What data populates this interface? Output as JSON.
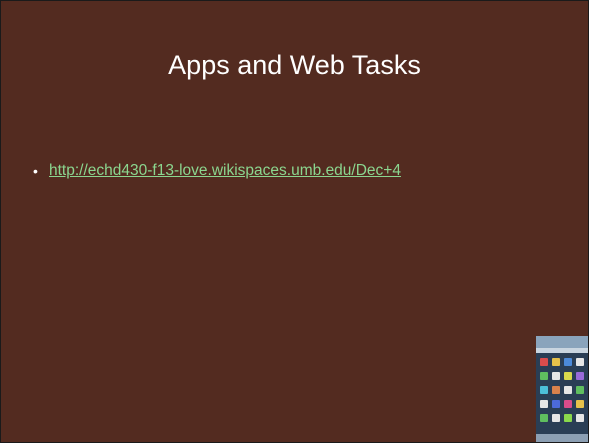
{
  "slide": {
    "title": "Apps and Web Tasks",
    "bullets": [
      {
        "marker": "•",
        "link_text": "http://echd430-f13-love.wikispaces.umb.edu/Dec+4"
      }
    ]
  },
  "thumbnail": {
    "cell_colors": [
      "#d94c4c",
      "#e6c14a",
      "#4c8ad9",
      "#e6e6e6",
      "#5fbf5f",
      "#e6e6e6",
      "#d9d94c",
      "#9a6ad9",
      "#4cbfd9",
      "#d9824c",
      "#e6e6e6",
      "#5fbf5f",
      "#e6e6e6",
      "#4c6ad9",
      "#d94c8a",
      "#e6c14a",
      "#5fbf5f",
      "#e6e6e6",
      "#8ad94c",
      "#e6e6e6"
    ]
  },
  "colors": {
    "slide_background": "#532b20",
    "title_text": "#ffffff",
    "link": "#8bd68f"
  }
}
